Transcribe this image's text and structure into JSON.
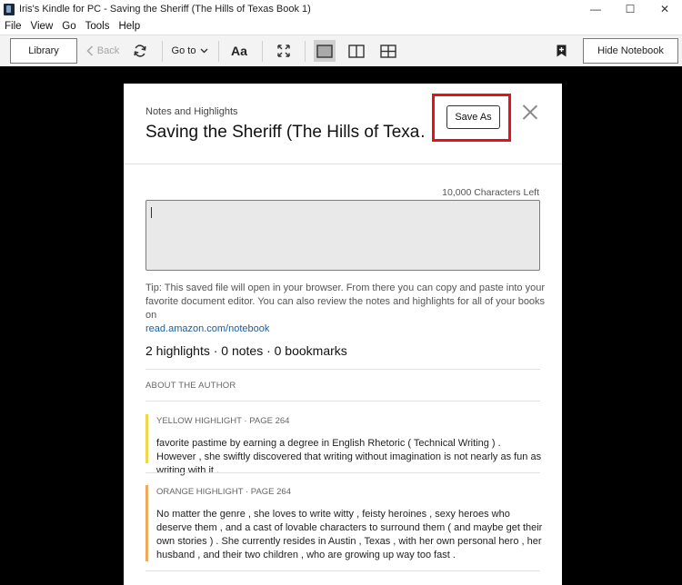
{
  "window": {
    "title": "Iris's Kindle for PC - Saving the Sheriff (The Hills of Texas Book 1)",
    "minimize": "—",
    "maximize": "☐",
    "close": "✕"
  },
  "menu": [
    "File",
    "View",
    "Go",
    "Tools",
    "Help"
  ],
  "toolbar": {
    "library": "Library",
    "back": "Back",
    "goto": "Go to",
    "font": "Aa",
    "hide_notebook": "Hide Notebook"
  },
  "notebook": {
    "label": "Notes and Highlights",
    "book_title": "Saving the Sheriff (The Hills of Texa…",
    "save_as": "Save As",
    "chars_left": "10,000 Characters Left",
    "note_value": "",
    "tip": "Tip: This saved file will open in your browser. From there you can copy and paste into your favorite document editor. You can also review the notes and highlights for all of your books on",
    "tip_link": "read.amazon.com/notebook",
    "counts": "2 highlights · 0 notes · 0 bookmarks",
    "section": "ABOUT THE AUTHOR",
    "highlights": [
      {
        "meta": "YELLOW HIGHLIGHT · PAGE 264",
        "color": "#f2d649",
        "text": "favorite pastime by earning a degree in English Rhetoric ( Technical Writing ) . However , she swiftly discovered that writing without imagination is not nearly as fun as writing with it ."
      },
      {
        "meta": "ORANGE HIGHLIGHT · PAGE 264",
        "color": "#f0a85a",
        "text": "No matter the genre , she loves to write witty , feisty heroines , sexy heroes who deserve them , and a cast of lovable characters to surround them ( and maybe get their own stories ) . She currently resides in Austin , Texas , with her own personal hero , her husband , and their two children , who are growing up way too fast ."
      }
    ]
  },
  "colors": {
    "reader_bg": "#000000",
    "annotation_box": "#e8111b",
    "link": "#1a5c9e"
  }
}
